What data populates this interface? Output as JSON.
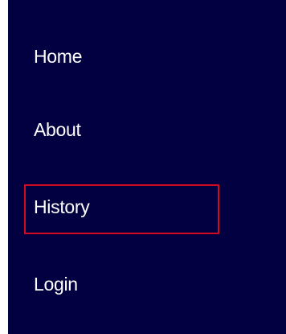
{
  "nav": {
    "items": [
      {
        "id": "home",
        "label": "Home"
      },
      {
        "id": "about",
        "label": "About"
      },
      {
        "id": "history",
        "label": "History",
        "highlighted": true
      },
      {
        "id": "login",
        "label": "Login"
      }
    ]
  },
  "colors": {
    "nav_background": "#020040",
    "text": "#ffffff",
    "highlight_border": "#d10a1e"
  }
}
